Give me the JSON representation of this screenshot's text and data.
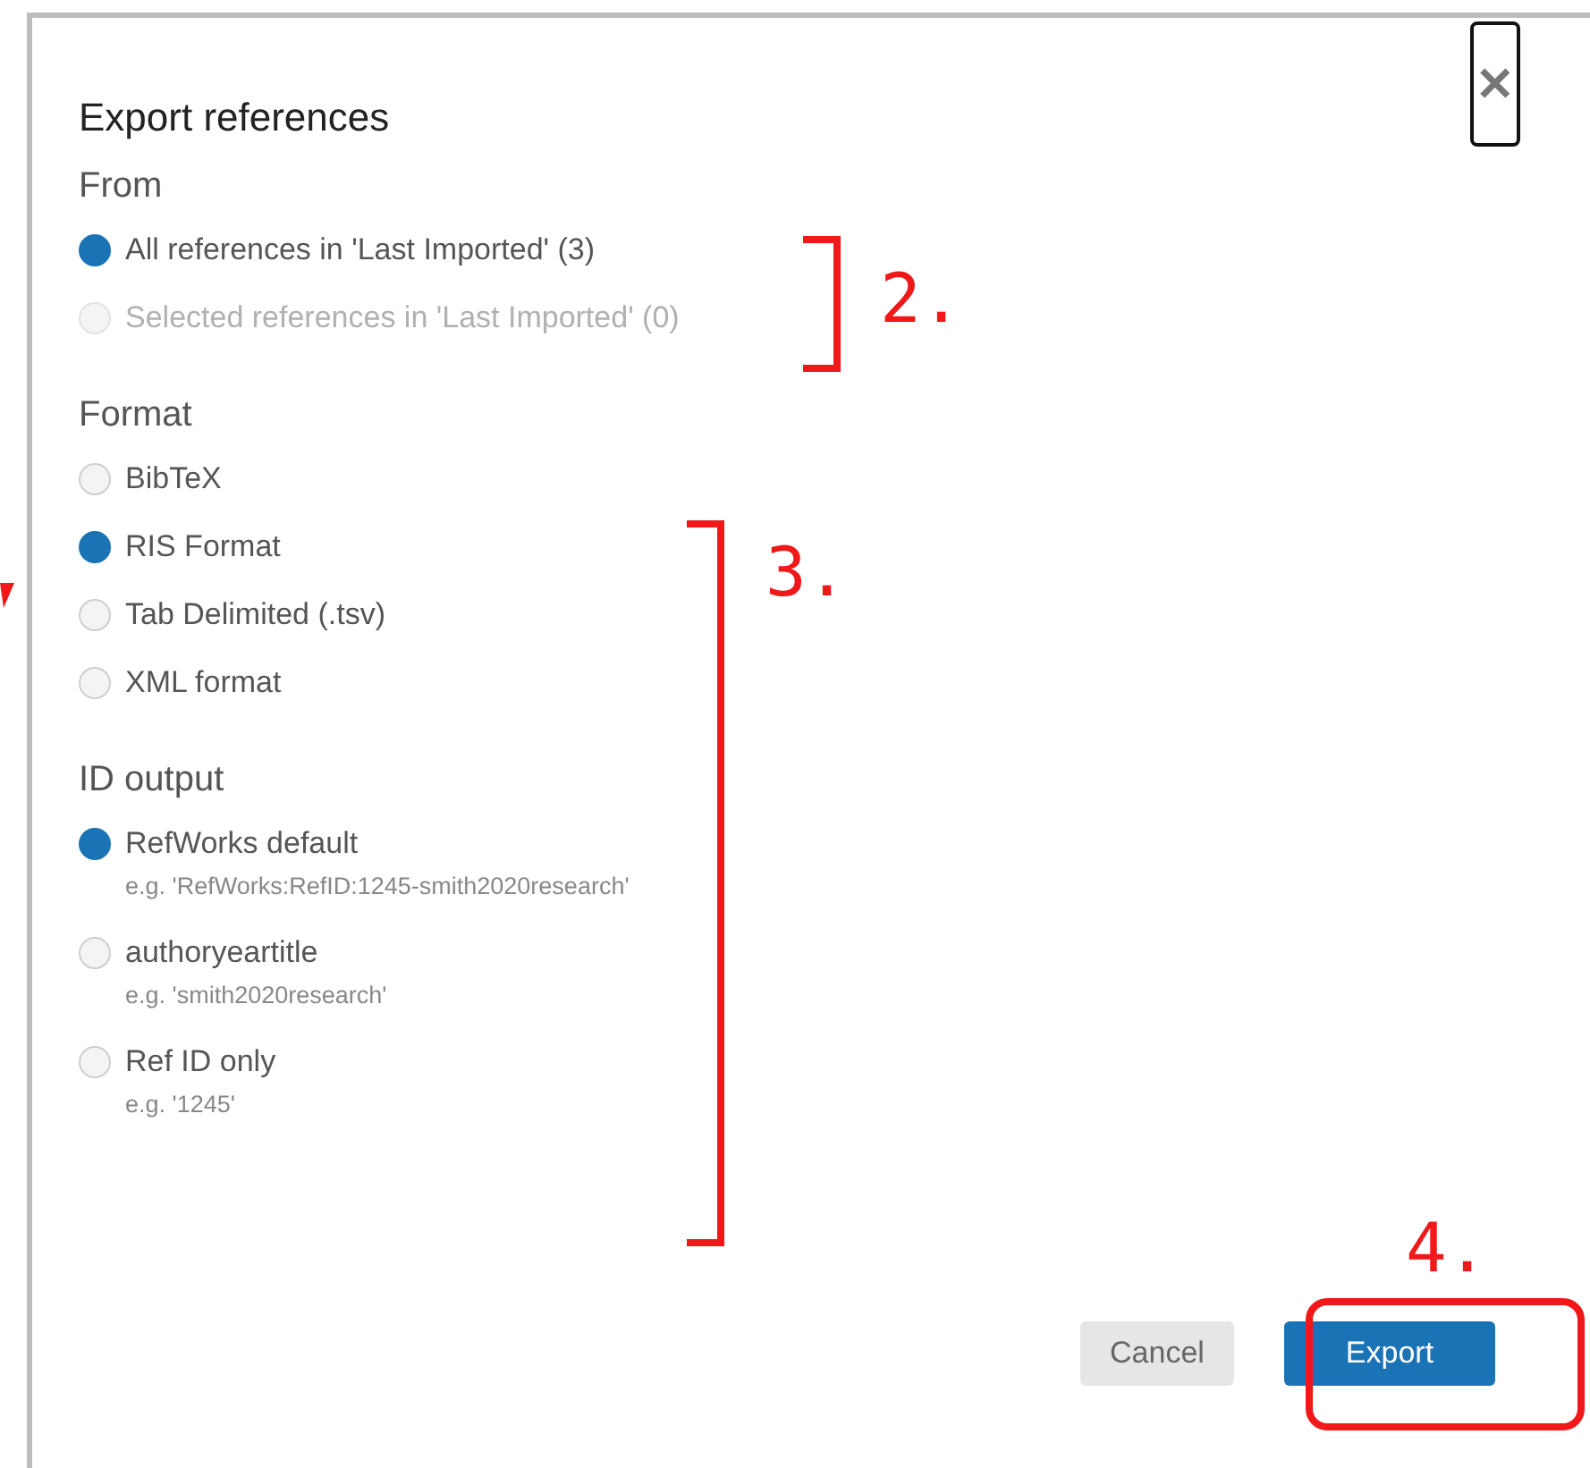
{
  "dialog": {
    "title": "Export references",
    "close": "✕",
    "sections": [
      {
        "label": "From",
        "options": [
          {
            "label": "All references in 'Last Imported' (3)",
            "selected": true,
            "disabled": false
          },
          {
            "label": "Selected references in 'Last Imported' (0)",
            "selected": false,
            "disabled": true
          }
        ]
      },
      {
        "label": "Format",
        "options": [
          {
            "label": "BibTeX",
            "selected": false,
            "disabled": false
          },
          {
            "label": "RIS Format",
            "selected": true,
            "disabled": false
          },
          {
            "label": "Tab Delimited (.tsv)",
            "selected": false,
            "disabled": false
          },
          {
            "label": "XML format",
            "selected": false,
            "disabled": false
          }
        ]
      },
      {
        "label": "ID output",
        "options": [
          {
            "label": "RefWorks default",
            "example": "e.g. 'RefWorks:RefID:1245-smith2020research'",
            "selected": true,
            "disabled": false
          },
          {
            "label": "authoryeartitle",
            "example": "e.g. 'smith2020research'",
            "selected": false,
            "disabled": false
          },
          {
            "label": "Ref ID only",
            "example": "e.g. '1245'",
            "selected": false,
            "disabled": false
          }
        ]
      }
    ],
    "buttons": [
      {
        "label": "Cancel",
        "kind": "secondary"
      },
      {
        "label": "Export",
        "kind": "primary"
      }
    ]
  },
  "annotations": [
    {
      "label": "2."
    },
    {
      "label": "3."
    },
    {
      "label": "4."
    }
  ]
}
